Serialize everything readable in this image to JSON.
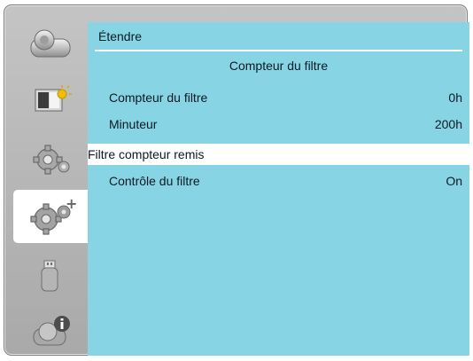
{
  "window": {
    "title": "Étendre",
    "section_title": "Compteur du filtre"
  },
  "sidebar": {
    "tabs": [
      {
        "icon": "projector-icon",
        "selected": false
      },
      {
        "icon": "picture-adjust-icon",
        "selected": false
      },
      {
        "icon": "settings-gear-icon",
        "selected": false
      },
      {
        "icon": "extended-settings-icon",
        "selected": true
      },
      {
        "icon": "usb-icon",
        "selected": false
      },
      {
        "icon": "information-icon",
        "selected": false
      }
    ]
  },
  "menu": {
    "rows": [
      {
        "label": "Compteur du filtre",
        "value": "0h",
        "selected": false
      },
      {
        "label": "Minuteur",
        "value": "200h",
        "selected": false
      },
      {
        "label": "Filtre compteur remis",
        "value": "",
        "selected": true
      },
      {
        "label": "Contrôle du filtre",
        "value": "On",
        "selected": false
      }
    ]
  },
  "colors": {
    "panel": "#87d5e4",
    "frame": "#b7b7b7",
    "highlight": "#ffffff"
  }
}
